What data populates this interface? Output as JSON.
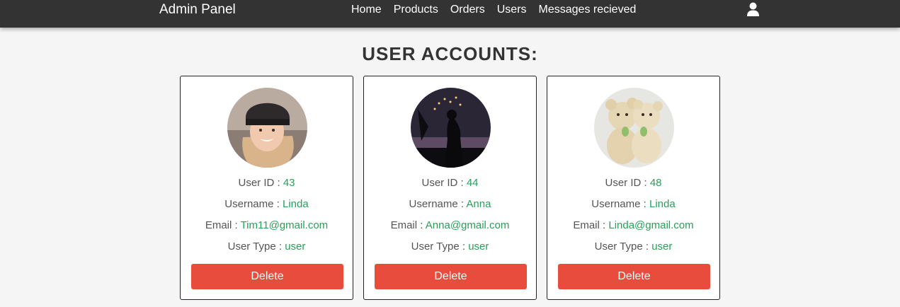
{
  "header": {
    "brand": "Admin Panel",
    "nav": [
      {
        "label": "Home"
      },
      {
        "label": "Products"
      },
      {
        "label": "Orders"
      },
      {
        "label": "Users"
      },
      {
        "label": "Messages recieved"
      }
    ],
    "user_icon": "user-icon"
  },
  "page": {
    "title": "USER ACCOUNTS:"
  },
  "colors": {
    "accent_value": "#28a05a",
    "delete_button": "#e74c3c",
    "header_bg": "#333333"
  },
  "users": [
    {
      "id_label": "User ID : ",
      "id": "43",
      "username_label": "Username : ",
      "username": "Linda",
      "email_label": "Email : ",
      "email": "Tim11@gmail.com",
      "type_label": "User Type : ",
      "type": "user",
      "delete_label": "Delete",
      "avatar": "avatar-woman-beanie"
    },
    {
      "id_label": "User ID : ",
      "id": "44",
      "username_label": "Username : ",
      "username": "Anna",
      "email_label": "Email : ",
      "email": "Anna@gmail.com",
      "type_label": "User Type : ",
      "type": "user",
      "delete_label": "Delete",
      "avatar": "avatar-night-silhouette"
    },
    {
      "id_label": "User ID : ",
      "id": "48",
      "username_label": "Username : ",
      "username": "Linda",
      "email_label": "Email : ",
      "email": "Linda@gmail.com",
      "type_label": "User Type : ",
      "type": "user",
      "delete_label": "Delete",
      "avatar": "avatar-teddy-bears"
    }
  ]
}
